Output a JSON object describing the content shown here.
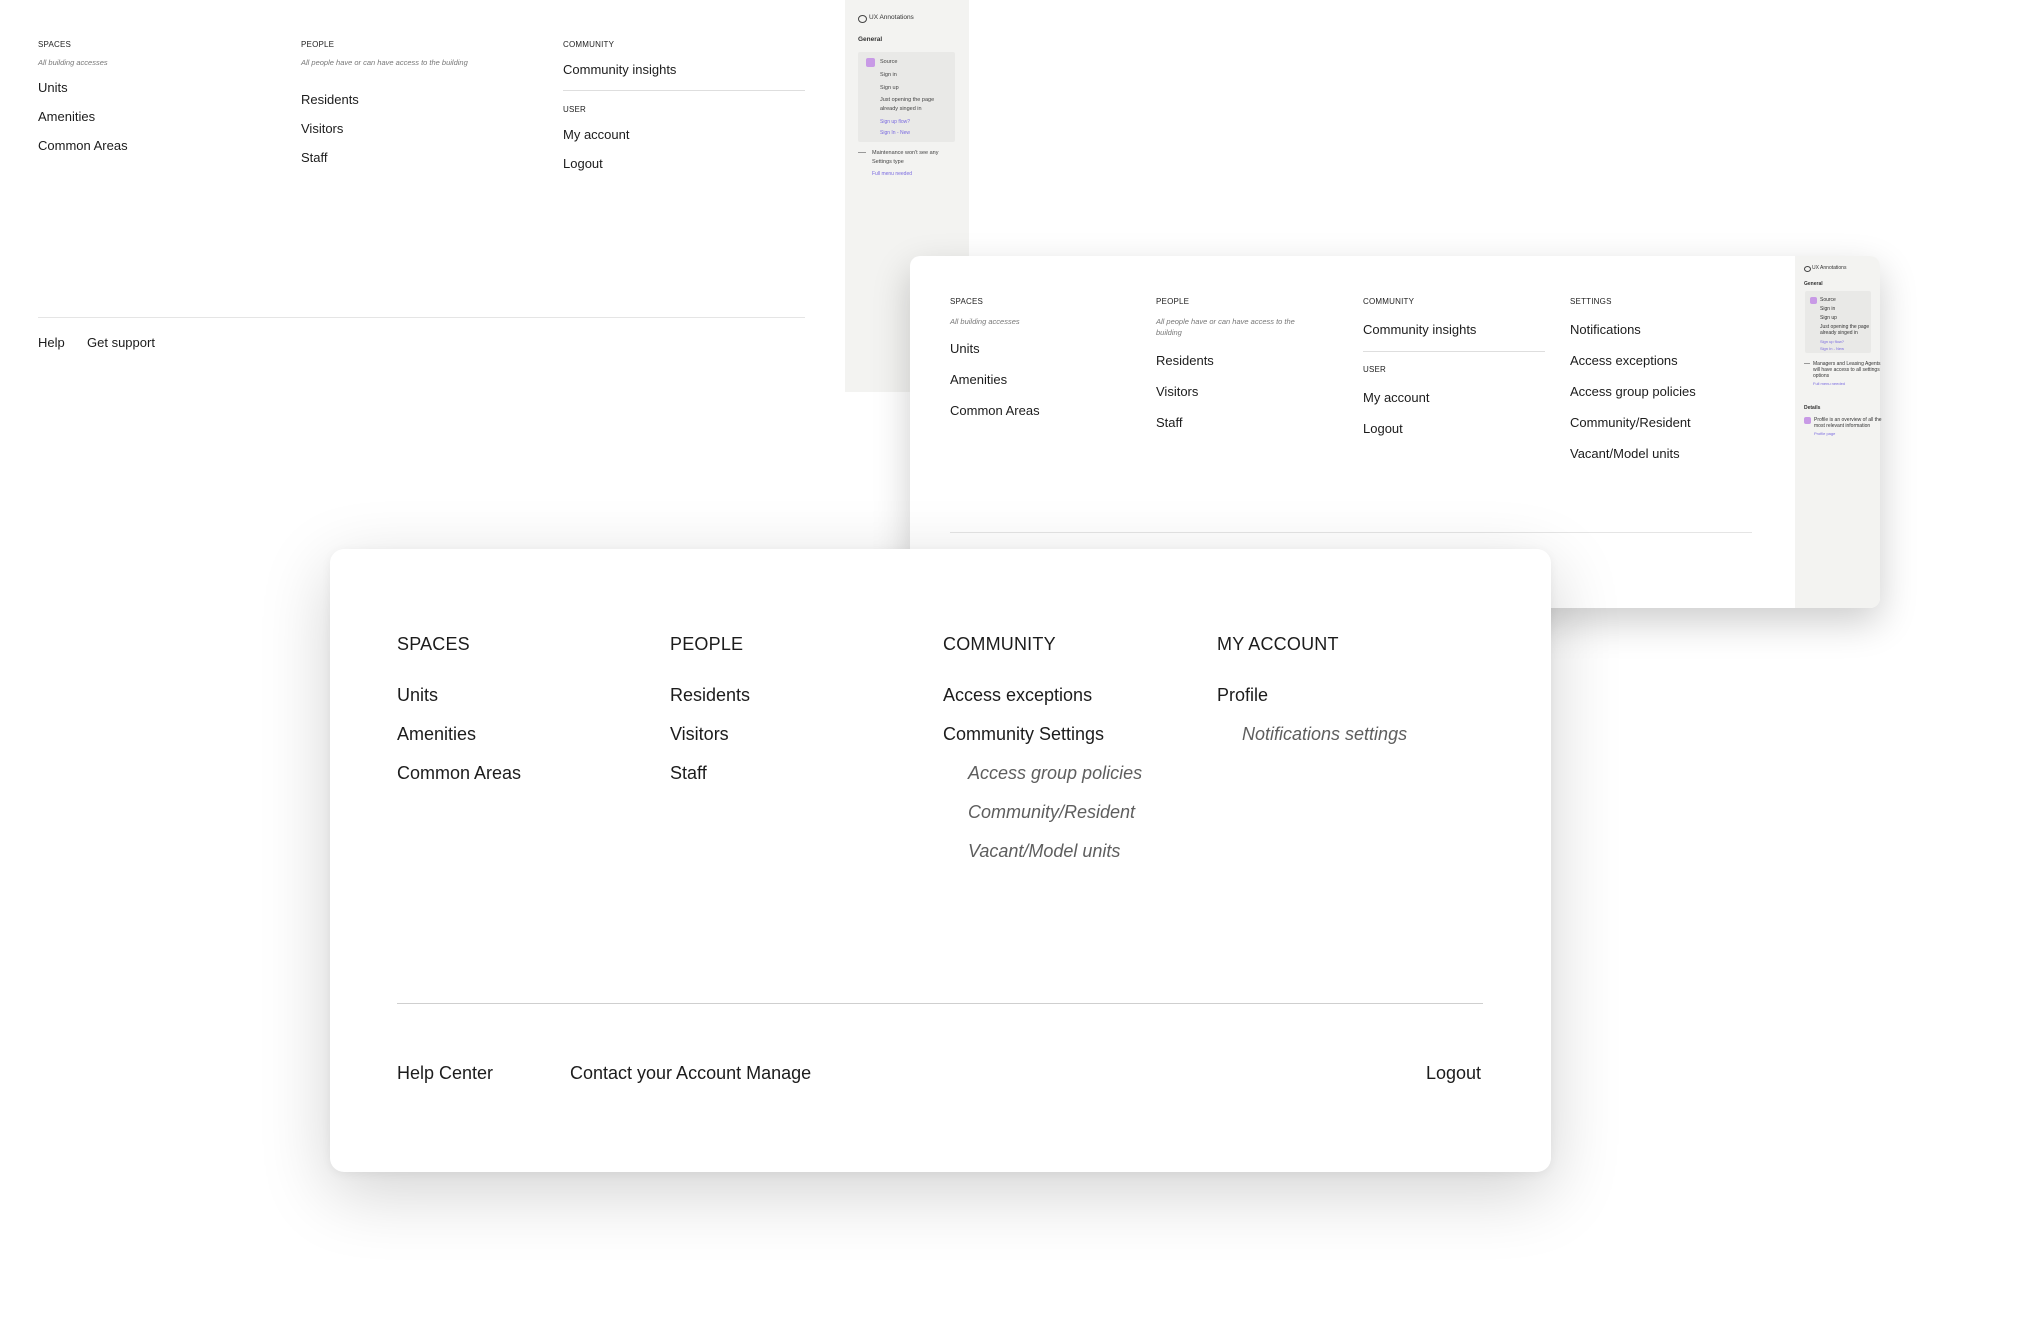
{
  "panel_top": {
    "spaces": {
      "heading": "SPACES",
      "subtitle": "All building accesses",
      "items": [
        "Units",
        "Amenities",
        "Common Areas"
      ]
    },
    "people": {
      "heading": "PEOPLE",
      "subtitle": "All people have or can have access to the building",
      "items": [
        "Residents",
        "Visitors",
        "Staff"
      ]
    },
    "community": {
      "heading": "COMMUNITY",
      "items": [
        "Community insights"
      ]
    },
    "user": {
      "heading": "USER",
      "items": [
        "My account",
        "Logout"
      ]
    },
    "footer": {
      "help": "Help",
      "support": "Get support"
    }
  },
  "annotations_top": {
    "title": "UX Annotations",
    "section": "General",
    "source_label": "Source",
    "lines": [
      "Sign in",
      "Sign up",
      "Just opening the page",
      "already singed in"
    ],
    "links": [
      "Sign up flow?",
      "Sign In - New"
    ],
    "note_lines": [
      "Maintenance won't see any",
      "Settings type"
    ],
    "note_link": "Full menu needed"
  },
  "panel_mid": {
    "spaces": {
      "heading": "SPACES",
      "subtitle": "All building accesses",
      "items": [
        "Units",
        "Amenities",
        "Common Areas"
      ]
    },
    "people": {
      "heading": "PEOPLE",
      "subtitle_lines": [
        "All people have or can have access to the",
        "building"
      ],
      "items": [
        "Residents",
        "Visitors",
        "Staff"
      ]
    },
    "community": {
      "heading": "COMMUNITY",
      "items": [
        "Community insights"
      ]
    },
    "user": {
      "heading": "USER",
      "items": [
        "My account",
        "Logout"
      ]
    },
    "settings": {
      "heading": "SETTINGS",
      "items": [
        "Notifications",
        "Access exceptions",
        "Access group policies",
        "Community/Resident",
        "Vacant/Model units"
      ]
    }
  },
  "annotations_mid": {
    "title": "UX Annotations",
    "section": "General",
    "source_label": "Source",
    "lines": [
      "Sign in",
      "Sign up",
      "Just opening the page",
      "already singed in"
    ],
    "links": [
      "Sign up flow?",
      "Sign In - New"
    ],
    "note_lines": [
      "Managers and Leasing Agents",
      "will have access to all settings",
      "options"
    ],
    "note_link": "Full menu needed",
    "section2": "Details",
    "detail_lines": [
      "Profile is an overview of all the",
      "most relevant information"
    ],
    "detail_link": "Profile page"
  },
  "panel_main": {
    "columns": [
      {
        "heading": "SPACES",
        "items": [
          "Units",
          "Amenities",
          "Common Areas"
        ],
        "subitems": []
      },
      {
        "heading": "PEOPLE",
        "items": [
          "Residents",
          "Visitors",
          "Staff"
        ],
        "subitems": []
      },
      {
        "heading": "COMMUNITY",
        "items": [
          "Access exceptions",
          "Community Settings"
        ],
        "subitems": [
          "Access group policies",
          "Community/Resident",
          "Vacant/Model units"
        ]
      },
      {
        "heading": "MY ACCOUNT",
        "items": [
          "Profile"
        ],
        "subitems": [
          "Notifications settings"
        ]
      }
    ],
    "footer": {
      "help": "Help Center",
      "contact": "Contact your Account Manage",
      "logout": "Logout"
    }
  },
  "colors": {
    "annotation_link": "#7a6ae0",
    "annotation_badge": "#c89ae6",
    "sidebar_bg": "#f3f3f1",
    "divider": "#cfcfcf"
  }
}
